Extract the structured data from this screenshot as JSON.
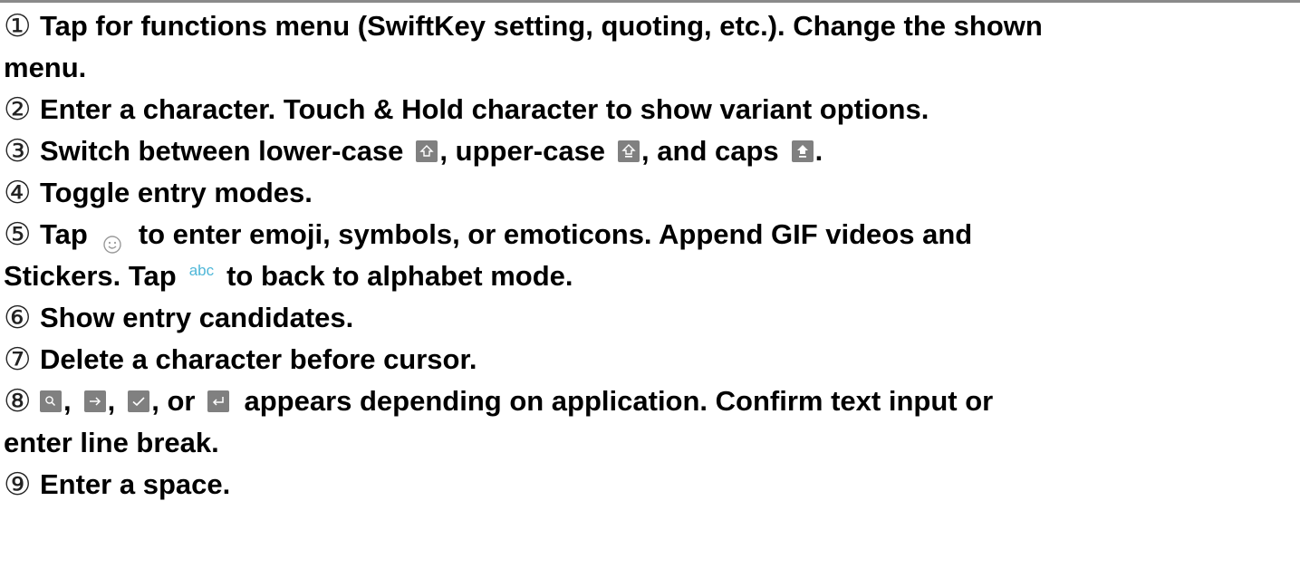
{
  "markers": [
    "①",
    "②",
    "③",
    "④",
    "⑤",
    "⑥",
    "⑦",
    "⑧",
    "⑨"
  ],
  "item1": {
    "line1": "Tap for functions menu (SwiftKey setting, quoting, etc.). Change the shown",
    "line2": "menu."
  },
  "item2": {
    "text": "Enter a character. Touch & Hold character to show variant options."
  },
  "item3": {
    "text_a": "Switch between lower-case",
    "text_b": ", upper-case",
    "text_c": ", and caps",
    "text_d": "."
  },
  "item4": {
    "text": "Toggle entry modes."
  },
  "item5": {
    "text_a": "Tap",
    "text_b": "to enter emoji, symbols, or emoticons. Append GIF videos and",
    "line2_a": "Stickers. Tap",
    "abc_label": "abc",
    "line2_b": "to back to alphabet mode."
  },
  "item6": {
    "text": "Show entry candidates."
  },
  "item7": {
    "text": "Delete a character before cursor."
  },
  "item8": {
    "sep1": ",",
    "sep2": ",",
    "sep3": ", or",
    "text_a": "appears depending on application. Confirm text input or",
    "line2": "enter line break."
  },
  "item9": {
    "text": "Enter a space."
  },
  "icons": {
    "lower_case": "shift-outline-icon",
    "upper_case": "shift-underline-icon",
    "caps": "shift-filled-icon",
    "emoji": "smiley-icon",
    "search": "search-key-icon",
    "next": "arrow-right-key-icon",
    "done": "checkmark-key-icon",
    "enter": "enter-key-icon"
  },
  "colors": {
    "key_background": "#808080",
    "abc_accent": "#4fb7d8",
    "top_rule": "#8a8a8a"
  }
}
